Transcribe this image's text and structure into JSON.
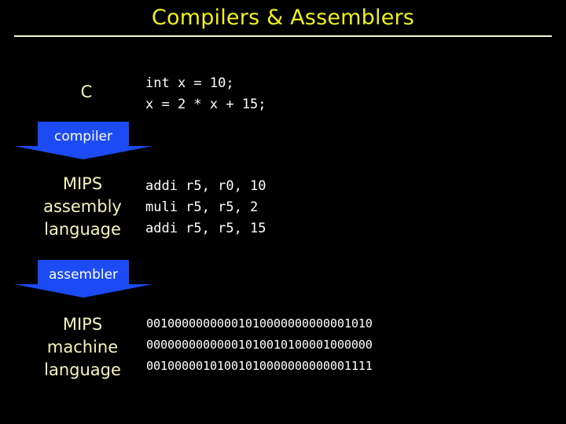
{
  "slide": {
    "title": "Compilers & Assemblers",
    "background_color": "#000000",
    "title_color": "#f2f216",
    "rule_color": "#f7f7cf",
    "label_color": "#f5f5bb",
    "code_color": "#ffffff",
    "arrow_color": "#1c4bf5"
  },
  "stages": [
    {
      "label": "C",
      "code": "int x = 10;\nx = 2 * x + 15;"
    },
    {
      "label": "MIPS\nassembly\nlanguage",
      "code": "addi r5, r0, 10\nmuli r5, r5, 2\naddi r5, r5, 15"
    },
    {
      "label": "MIPS\nmachine\nlanguage",
      "code": "00100000000001010000000000001010\n00000000000001010010100001000000\n00100000101001010000000000001111"
    }
  ],
  "arrows": [
    {
      "label": "compiler"
    },
    {
      "label": "assembler"
    }
  ]
}
